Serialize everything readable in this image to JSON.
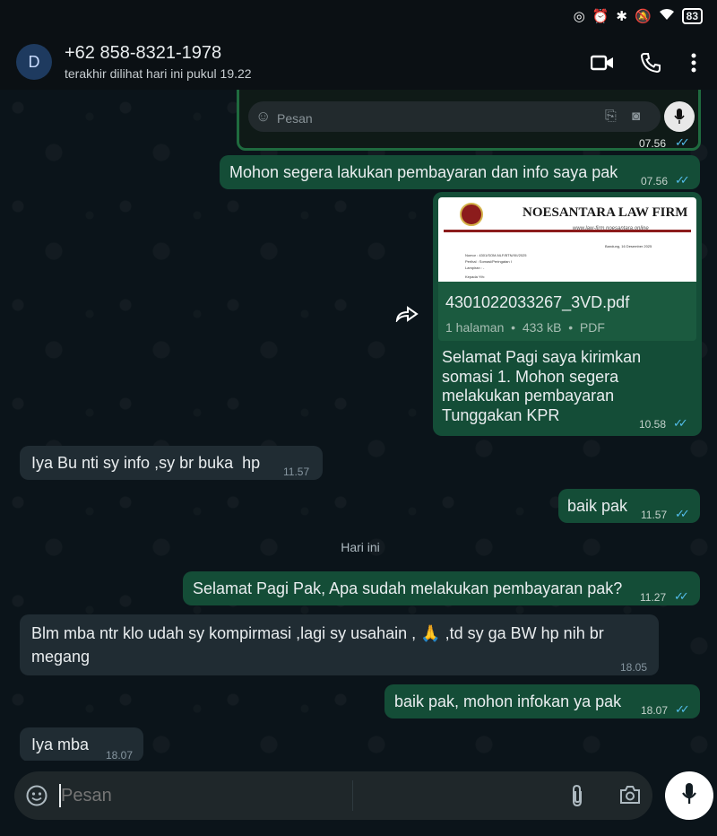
{
  "status_bar": {
    "battery": "83"
  },
  "header": {
    "avatar_letter": "D",
    "contact": "+62 858-8321-1978",
    "last_seen": "terakhir dilihat hari ini pukul 19.22"
  },
  "messages": {
    "partial_screenshot": {
      "placeholder": "Pesan",
      "time": "07.56"
    },
    "m1": {
      "text": "Mohon segera lakukan pembayaran dan info saya pak",
      "time": "07.56"
    },
    "m2": {
      "doc_header": "NOESANTARA LAW FIRM",
      "doc_sub": "www.law-firm.noesantara.online",
      "doc_date": "Bandung, 16 Desember 2025",
      "doc_lines": [
        "Nomor : 4301/SOM-NLF/BTN/XII/2025",
        "Perihal : Somasi/Peringatan I",
        "Lampiran : -",
        "Kepada Yth:",
        "Saudara/i : DEDE RAHMAT KURNIAWA"
      ],
      "file_name": "4301022033267_3VD.pdf",
      "pages": "1 halaman",
      "size": "433 kB",
      "type": "PDF",
      "caption": "Selamat Pagi saya kirimkan somasi 1. Mohon segera melakukan pembayaran Tunggakan KPR",
      "time": "10.58"
    },
    "m3": {
      "text": "Iya Bu nti sy info ,sy br buka  hp",
      "time": "11.57"
    },
    "m4": {
      "text": "baik pak",
      "time": "11.57"
    },
    "day_separator": "Hari ini",
    "m5": {
      "text": "Selamat Pagi Pak, Apa sudah melakukan pembayaran pak?",
      "time": "11.27"
    },
    "m6": {
      "text_a": "Blm mba ntr klo udah sy kompirmasi ,lagi sy usahain ,",
      "emoji": "🙏",
      "text_b": ",td sy ga BW hp nih br",
      "text_c": "megang",
      "time": "18.05"
    },
    "m7": {
      "text": "baik pak, mohon infokan ya pak",
      "time": "18.07"
    },
    "m8": {
      "text": "Iya mba",
      "time": "18.07"
    }
  },
  "composer": {
    "placeholder": "Pesan"
  },
  "colors": {
    "outgoing_bubble": "#144d37",
    "incoming_bubble": "#202c33",
    "read_ticks": "#53bdeb",
    "background": "#0b141a"
  },
  "icons": [
    "video-call-icon",
    "phone-icon",
    "more-options-icon",
    "forward-icon",
    "emoji-icon",
    "attach-icon",
    "camera-icon",
    "mic-icon"
  ]
}
